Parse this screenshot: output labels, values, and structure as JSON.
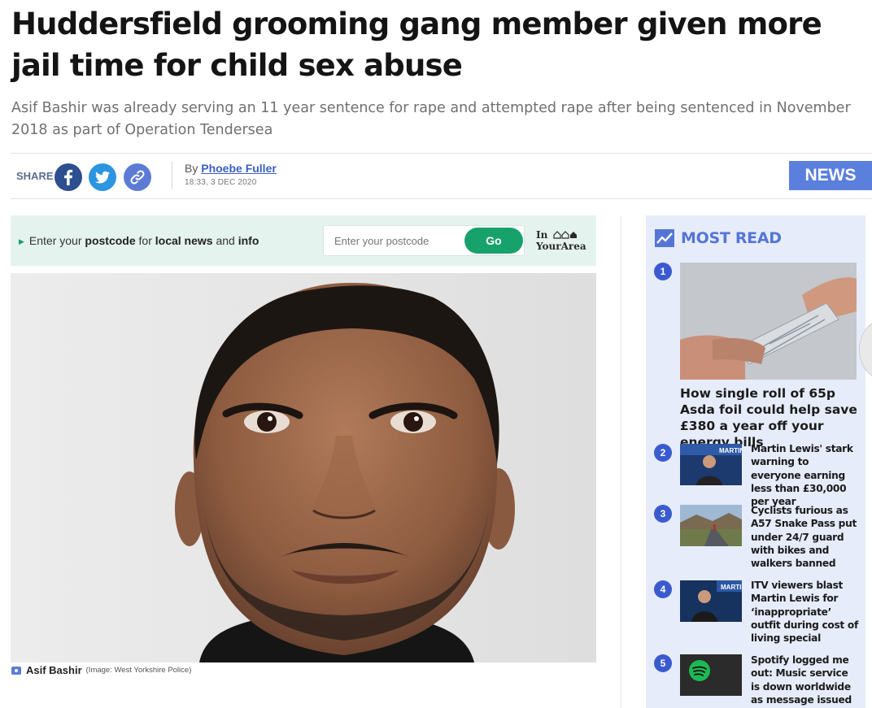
{
  "article": {
    "headline": "Huddersfield grooming gang member given more jail time for child sex abuse",
    "standfirst": "Asif Bashir was already serving an 11 year sentence for rape and attempted rape after being sentenced in November 2018 as part of Operation Tendersea",
    "share_label": "SHARE",
    "byline_prefix": "By",
    "author": "Phoebe Fuller",
    "timestamp": "18:33, 3 DEC 2020",
    "section": "NEWS",
    "image_caption": "Asif Bashir",
    "image_credit": "(Image: West Yorkshire Police)"
  },
  "share_icons": [
    "facebook-icon",
    "twitter-icon",
    "link-icon"
  ],
  "postcode": {
    "prompt_1": "Enter your ",
    "prompt_postcode": "postcode",
    "prompt_2": " for ",
    "prompt_local": "local news",
    "prompt_3": " and ",
    "prompt_info": "info",
    "placeholder": "Enter your postcode",
    "button": "Go",
    "logo_line1": "In",
    "logo_line2": "YourArea"
  },
  "most_read": {
    "title": "MOST READ",
    "items": [
      {
        "rank": "1",
        "title": "How single roll of 65p Asda foil could help save £380 a year off your energy bills"
      },
      {
        "rank": "2",
        "title": "Martin Lewis' stark warning to everyone earning less than £30,000 per year"
      },
      {
        "rank": "3",
        "title": "Cyclists furious as A57 Snake Pass put under 24/7 guard with bikes and walkers banned"
      },
      {
        "rank": "4",
        "title": "ITV viewers blast Martin Lewis for ‘inappropriate’ outfit during cost of living special"
      },
      {
        "rank": "5",
        "title": "Spotify logged me out: Music service is down worldwide as message issued to"
      }
    ]
  },
  "colors": {
    "accent": "#5b7fdc",
    "postcode_bg": "#e4f3ee",
    "go_button": "#17a26c",
    "most_read_bg": "#e7ecfb",
    "rank_badge": "#3a5bd0"
  }
}
